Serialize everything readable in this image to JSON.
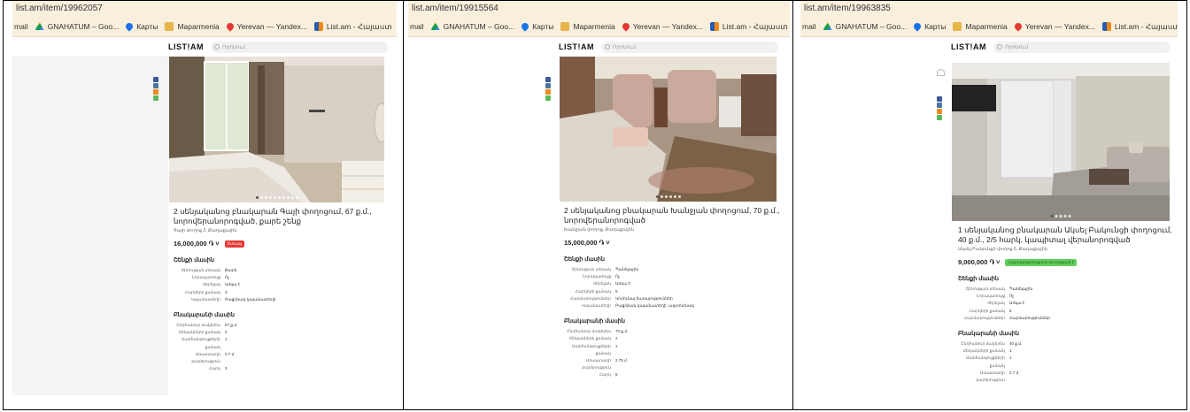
{
  "panels": [
    {
      "url": "list.am/item/19962057",
      "bookmarks": [
        "mail",
        "GNAHATUM – Goo...",
        "Карты",
        "Maparmenia",
        "Yerevan — Yandex...",
        "List.am - Հայաստ"
      ],
      "logo": "LIST!AM",
      "search_placeholder": "Որոնում",
      "title": "2 սենյականոց բնակարան Գայի փողոցում, 67 ք.մ., նորովերանորոգված, քարե շենք",
      "location": "Գայի փողոց 2, Քաղաքային",
      "price": "16,000,000 ֏ ˅",
      "badge": "Շտապ",
      "building_title": "Շենքի մասին",
      "building_rows": [
        [
          "Շինության տեսակ",
          "Քարե"
        ],
        [
          "Նորակառույց",
          "Ոչ"
        ],
        [
          "Վերելակ",
          "Առկա է"
        ],
        [
          "Հարկերի քանակ",
          "3"
        ],
        [
          "Կայանատեղի",
          "Բաց/փակ կայանատեղի"
        ]
      ],
      "apartment_title": "Բնակարանի մասին",
      "apartment_rows": [
        [
          "Ընդհանուր մակերես",
          "67 ք.մ."
        ],
        [
          "Սենյակների քանակ",
          "2"
        ],
        [
          "Սանհանգույցների քանակ",
          "1"
        ],
        [
          "Առաստաղի բարձրություն",
          "2.7 մ"
        ],
        [
          "Հարկ",
          "3"
        ]
      ]
    },
    {
      "url": "list.am/item/19915564",
      "bookmarks": [
        "mail",
        "GNAHATUM – Goo...",
        "Карты",
        "Maparmenia",
        "Yerevan — Yandex...",
        "List.am - Հայաստ"
      ],
      "logo": "LIST!AM",
      "search_placeholder": "Որոնում",
      "title": "2 սենյականոց բնակարան Խանջյան փողոցում, 70 ք.մ., նորովերանորոգված",
      "location": "Խանջյան փողոց, Քաղաքային",
      "price": "15,000,000 ֏ ˅",
      "badge": "",
      "building_title": "Շենքի մասին",
      "building_rows": [
        [
          "Շինության տեսակ",
          "Պանելային"
        ],
        [
          "Նորակառույց",
          "Ոչ"
        ],
        [
          "Վերելակ",
          "Առկա է"
        ],
        [
          "Հարկերի քանակ",
          "5"
        ],
        [
          "Հարմարություններ",
          "Կոմունալ ծառայություններ"
        ],
        [
          "Կայանատեղի",
          "Բաց/փակ կայանատեղի, ավտոտնակ"
        ]
      ],
      "apartment_title": "Բնակարանի մասին",
      "apartment_rows": [
        [
          "Ընդհանուր մակերես",
          "70 ք.մ."
        ],
        [
          "Սենյակների քանակ",
          "2"
        ],
        [
          "Սանհանգույցների քանակ",
          "1"
        ],
        [
          "Առաստաղի բարձրություն",
          "2.75 մ"
        ],
        [
          "Հարկ",
          "5"
        ]
      ]
    },
    {
      "url": "list.am/item/19963835",
      "bookmarks": [
        "mail",
        "GNAHATUM – Goo...",
        "Карты",
        "Maparmenia",
        "Yerevan — Yandex...",
        "List.am - Հայաստ"
      ],
      "logo": "LIST!AM",
      "search_placeholder": "Որոնում",
      "title": "1 սենյականոց բնակարան Ակսել Բակունցի փողոցում, 40 ք.մ., 2/5 հարկ, կապիտալ վերանորոգված",
      "location": "Ակսել Բակունցի փողոց 6, Քաղաքային",
      "price": "9,000,000 ֏ ˅",
      "badge": "Հայտարարություն ստուգված է",
      "building_title": "Շենքի մասին",
      "building_rows": [
        [
          "Շինության տեսակ",
          "Պանելային"
        ],
        [
          "Նորակառույց",
          "Ոչ"
        ],
        [
          "Վերելակ",
          "Առկա է"
        ],
        [
          "Հարկերի քանակ",
          "5"
        ],
        [
          "Հարմարություններ",
          "Հարմարություններ"
        ]
      ],
      "apartment_title": "Բնակարանի մասին",
      "apartment_rows": [
        [
          "Ընդհանուր մակերես",
          "40 ք.մ."
        ],
        [
          "Սենյակների քանակ",
          "1"
        ],
        [
          "Սանհանգույցների քանակ",
          "1"
        ],
        [
          "Առաստաղի բարձրություն",
          "2.7 մ"
        ]
      ]
    }
  ],
  "colors": {
    "browser_bar": "#f8efdd",
    "badge_red": "#e53935",
    "badge_green": "#5fcf5a",
    "facebook": "#3b5998",
    "vk": "#4c75a3",
    "ok": "#f08a1a",
    "whatsapp": "#5cb85c"
  },
  "icons": [
    "google-drive-icon",
    "google-maps-pin-icon",
    "folder-icon",
    "location-pin-icon",
    "list-am-icon",
    "facebook-icon",
    "vk-icon",
    "odnoklassniki-icon",
    "whatsapp-icon",
    "heart-icon",
    "search-icon"
  ]
}
